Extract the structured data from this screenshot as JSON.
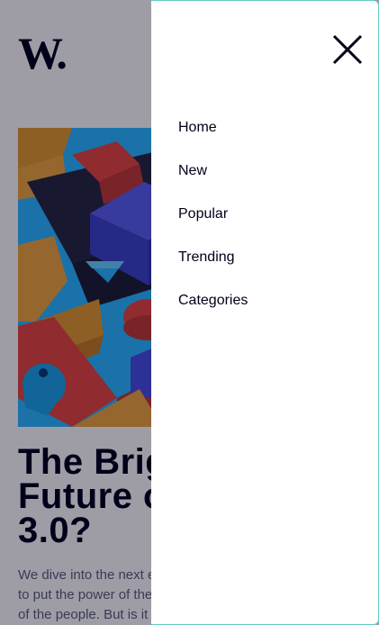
{
  "brand": {
    "logo_text": "W."
  },
  "article": {
    "hero_image": {
      "description_icon": "abstract-3d-blocks-image"
    },
    "headline_lines": [
      "The Bright",
      "Future of Web",
      "3.0?"
    ],
    "excerpt_lines": [
      "We dive into the next evolution of the web that claims",
      "to put the power of the platforms back into the hands",
      "of the people. But is it really fulfilling its promise?"
    ]
  },
  "menu": {
    "close_icon": "close-icon",
    "items": [
      {
        "label": "Home"
      },
      {
        "label": "New"
      },
      {
        "label": "Popular"
      },
      {
        "label": "Trending"
      },
      {
        "label": "Categories"
      }
    ]
  },
  "colors": {
    "text_dark": "#00001a",
    "excerpt": "#5d5f79",
    "overlay": "rgba(0,0,26,0.38)",
    "panel_border": "#64c9c1"
  }
}
